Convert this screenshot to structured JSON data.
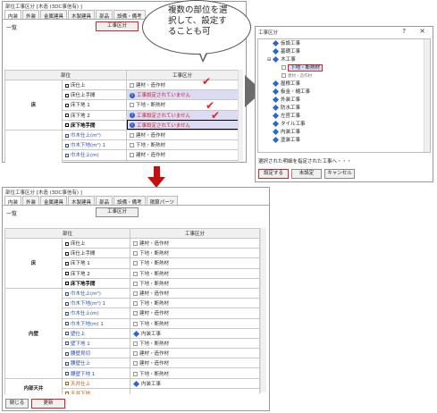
{
  "top_window": {
    "title": "部位工事区分 [木造 (3DC事信有) ]",
    "tabs": [
      "内装",
      "外装",
      "金属建具",
      "木製建具",
      "部品",
      "設備・備考"
    ],
    "list_label": "一覧",
    "kouji_button": "工事区分",
    "col_part": "部位",
    "col_kouji": "工事区分",
    "rows": [
      {
        "group": "",
        "part": "床仕上",
        "value": "建材・造作材",
        "style": "",
        "vstyle": ""
      },
      {
        "group": "",
        "part": "床仕上手間",
        "value": "工事設定されていません",
        "style": "",
        "vstyle": "warn"
      },
      {
        "group": "床",
        "part": "床下地 1",
        "value": "下地・断熱材",
        "style": "",
        "vstyle": ""
      },
      {
        "group": "",
        "part": "床下地 2",
        "value": "工事設定されていません",
        "style": "",
        "vstyle": "warn"
      },
      {
        "group": "",
        "part": "床下地手間",
        "value": "工事設定されていません",
        "style": "bold",
        "vstyle": "warn sel"
      },
      {
        "group": "",
        "part": "巾木仕上(m²)",
        "value": "建材・造作材",
        "style": "blue",
        "vstyle": ""
      },
      {
        "group": "",
        "part": "巾木下地(m²) 1",
        "value": "下地・断熱材",
        "style": "blue",
        "vstyle": ""
      },
      {
        "group": "",
        "part": "巾木仕上(m)",
        "value": "建材・造作材",
        "style": "blue",
        "vstyle": ""
      },
      {
        "group": "",
        "part": "巾木下地(m) 1",
        "value": "下地・断熱材",
        "style": "blue",
        "vstyle": ""
      }
    ]
  },
  "bubble_text": [
    "複数の部位を選",
    "択して、設定す",
    "ることも可"
  ],
  "dialog": {
    "title": "工事区分",
    "help": "?",
    "close": "×",
    "tree": [
      "仮設工事",
      "基礎工事",
      "木工事",
      "下地・断熱材",
      "建材・造作材",
      "屋根工事",
      "板金・樋工事",
      "外装工事",
      "防水工事",
      "左官工事",
      "タイル工事",
      "内装工事",
      "塗装工事"
    ],
    "status": "選択された明細を指定された工事へ・・・",
    "btn_set": "設定する",
    "btn_unset": "未設定",
    "btn_cancel": "キャンセル"
  },
  "bottom_window": {
    "title": "部位工事区分 [木造 (3DC事信有) ]",
    "tabs": [
      "内装",
      "外装",
      "金属建具",
      "木製建具",
      "部品",
      "設備・備考",
      "積算パーツ"
    ],
    "list_label": "一覧",
    "kouji_button": "工事区分",
    "col_part": "部位",
    "col_kouji": "工事区分",
    "rows": [
      {
        "group": "",
        "part": "床仕上",
        "value": "建材・造作材",
        "style": "",
        "icon": false
      },
      {
        "group": "",
        "part": "床仕上手間",
        "value": "下地・断熱材",
        "style": "",
        "icon": false
      },
      {
        "group": "床",
        "part": "床下地 1",
        "value": "下地・断熱材",
        "style": "",
        "icon": false
      },
      {
        "group": "",
        "part": "床下地 2",
        "value": "下地・断熱材",
        "style": "",
        "icon": false
      },
      {
        "group": "",
        "part": "床下地手間",
        "value": "下地・断熱材",
        "style": "bold",
        "icon": false
      },
      {
        "group": "",
        "part": "巾木仕上(m²)",
        "value": "建材・造作材",
        "style": "blue",
        "icon": false
      },
      {
        "group": "",
        "part": "巾木下地(m²) 1",
        "value": "下地・断熱材",
        "style": "blue",
        "icon": false
      },
      {
        "group": "",
        "part": "巾木仕上(m)",
        "value": "建材・造作材",
        "style": "blue",
        "icon": false
      },
      {
        "group": "内壁",
        "part": "巾木下地(m) 1",
        "value": "下地・断熱材",
        "style": "blue",
        "icon": false
      },
      {
        "group": "",
        "part": "壁仕上",
        "value": "内装工事",
        "style": "blue",
        "icon": true
      },
      {
        "group": "",
        "part": "壁下地 1",
        "value": "下地・断熱材",
        "style": "blue",
        "icon": false
      },
      {
        "group": "",
        "part": "腰壁見切",
        "value": "建材・造作材",
        "style": "blue",
        "icon": false
      },
      {
        "group": "",
        "part": "腰壁仕上",
        "value": "建材・造作材",
        "style": "blue",
        "icon": false
      },
      {
        "group": "",
        "part": "腰壁下地 1",
        "value": "下地・断熱材",
        "style": "blue",
        "icon": false
      },
      {
        "group": "",
        "part": "天井仕上",
        "value": "内装工事",
        "style": "orange",
        "icon": true
      },
      {
        "group": "内部天井",
        "part": "天井下地",
        "value": "",
        "style": "orange",
        "icon": false
      }
    ],
    "btn_close": "閉じる",
    "btn_update": "更新"
  }
}
